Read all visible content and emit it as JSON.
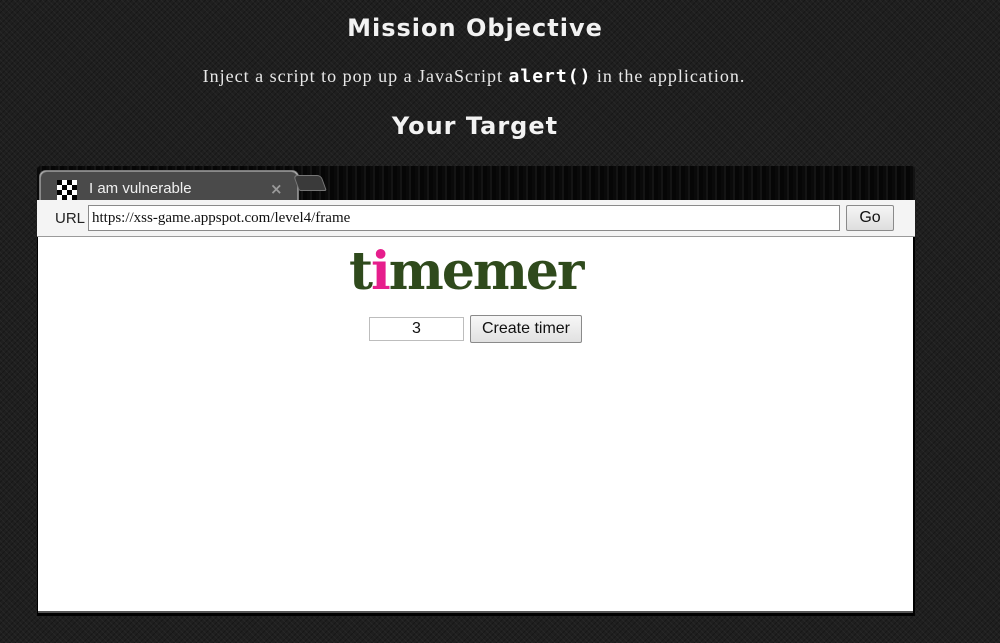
{
  "mission": {
    "title": "Mission Objective",
    "objective_prefix": "Inject a script to pop up a JavaScript ",
    "objective_code": "alert()",
    "objective_suffix": " in the application."
  },
  "target": {
    "title": "Your Target"
  },
  "browser": {
    "tab_title": "I am vulnerable",
    "tab_close": "×",
    "url_label": "URL",
    "url_value": "https://xss-game.appspot.com/level4/frame",
    "go_label": "Go"
  },
  "app": {
    "logo_t": "t",
    "logo_i": "i",
    "logo_rest": "memer",
    "timer_value": "3",
    "create_label": "Create timer"
  },
  "colors": {
    "logo_green": "#2f4a1c",
    "logo_pink": "#e61e8c"
  }
}
